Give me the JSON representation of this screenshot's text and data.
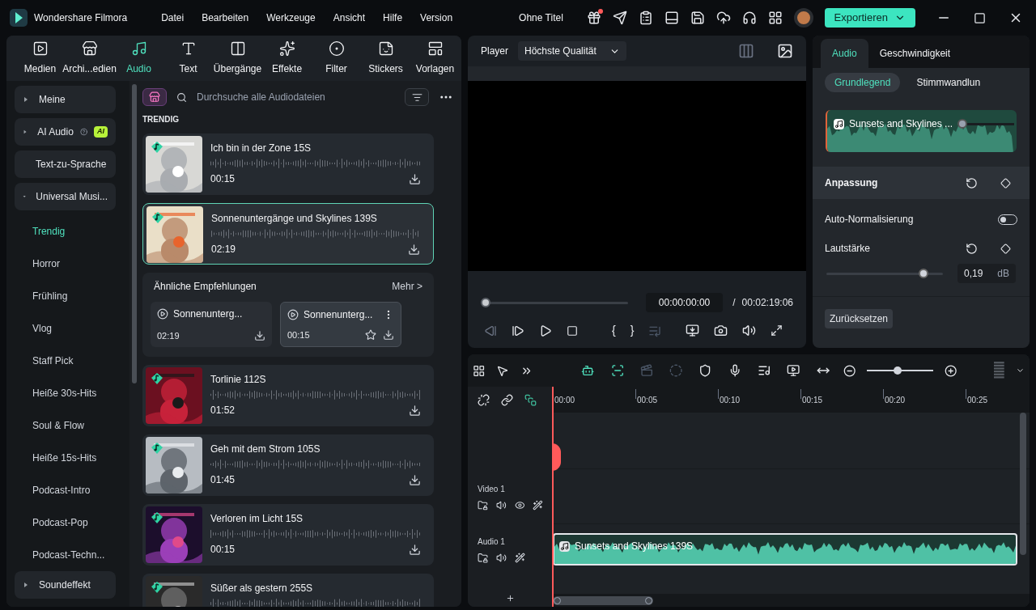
{
  "app": {
    "name": "Wondershare Filmora",
    "menus": [
      "Datei",
      "Bearbeiten",
      "Werkzeuge",
      "Ansicht",
      "Hilfe",
      "Version"
    ],
    "project_title": "Ohne Titel",
    "notification": true,
    "export_label": "Exportieren"
  },
  "media_tabs": [
    {
      "label": "Medien",
      "selected": false
    },
    {
      "label": "Archi...edien",
      "selected": false
    },
    {
      "label": "Audio",
      "selected": true
    },
    {
      "label": "Text",
      "selected": false
    },
    {
      "label": "Übergänge",
      "selected": false
    },
    {
      "label": "Effekte",
      "selected": false
    },
    {
      "label": "Filter",
      "selected": false
    },
    {
      "label": "Stickers",
      "selected": false
    },
    {
      "label": "Vorlagen",
      "selected": false
    }
  ],
  "sidebar": [
    {
      "kind": "group",
      "label": "Meine",
      "expanded": false
    },
    {
      "kind": "group",
      "label": "AI Audio",
      "expanded": false,
      "badge": "AI"
    },
    {
      "kind": "plain",
      "label": "Text-zu-Sprache"
    },
    {
      "kind": "group",
      "label": "Universal Musi...",
      "expanded": true,
      "children": [
        {
          "label": "Trendig",
          "selected": true
        },
        {
          "label": "Horror",
          "selected": false
        },
        {
          "label": "Frühling",
          "selected": false
        },
        {
          "label": "Vlog",
          "selected": false
        },
        {
          "label": "Staff Pick",
          "selected": false
        },
        {
          "label": "Heiße 30s-Hits",
          "selected": false
        },
        {
          "label": "Soul & Flow",
          "selected": false
        },
        {
          "label": "Heiße 15s-Hits",
          "selected": false
        },
        {
          "label": "Podcast-Intro",
          "selected": false
        },
        {
          "label": "Podcast-Pop",
          "selected": false
        },
        {
          "label": "Podcast-Techn...",
          "selected": false
        }
      ]
    },
    {
      "kind": "group",
      "label": "Soundeffekt",
      "expanded": false
    }
  ],
  "library": {
    "search_placeholder": "Durchsuche alle Audiodateien",
    "section": "TRENDIG",
    "items": [
      {
        "kind": "track",
        "title": "Ich bin in der Zone 15S",
        "duration": "00:15",
        "selected": false
      },
      {
        "kind": "track",
        "title": "Sonnenuntergänge und Skylines 139S",
        "duration": "02:19",
        "selected": true
      },
      {
        "kind": "recommendations",
        "title": "Ähnliche Empfehlungen",
        "more": "Mehr >",
        "items": [
          {
            "title": "Sonnenunterg...",
            "duration": "02:19",
            "highlighted": false
          },
          {
            "title": "Sonnenunterg...",
            "duration": "00:15",
            "highlighted": true
          }
        ]
      },
      {
        "kind": "track",
        "title": "Torlinie 112S",
        "duration": "01:52",
        "selected": false
      },
      {
        "kind": "track",
        "title": "Geh mit dem Strom 105S",
        "duration": "01:45",
        "selected": false
      },
      {
        "kind": "track",
        "title": "Verloren im Licht 15S",
        "duration": "00:15",
        "selected": false
      },
      {
        "kind": "track",
        "title": "Süßer als gestern 255S",
        "selected": false
      }
    ]
  },
  "player": {
    "label": "Player",
    "quality": "Höchste Qualität",
    "progress": {
      "level": 0
    },
    "current_time": "00:00:00:00",
    "separator": "/",
    "total_time": "00:02:19:06",
    "mark_in": "{",
    "mark_out": "}"
  },
  "inspector": {
    "tabs": [
      {
        "label": "Audio",
        "selected": true
      },
      {
        "label": "Geschwindigkeit",
        "selected": false
      }
    ],
    "subtabs": [
      {
        "label": "Grundlegend",
        "selected": true
      },
      {
        "label": "Stimmwandlun",
        "selected": false
      }
    ],
    "clip_title": "Sunsets and Skylines ...",
    "section": "Anpassung",
    "auto_normalization": {
      "label": "Auto-Normalisierung",
      "on": false
    },
    "volume": {
      "label": "Lautstärke",
      "level": 0.83,
      "value": "0,19",
      "unit": "dB"
    },
    "reset_label": "Zurücksetzen"
  },
  "timeline": {
    "zoom": {
      "level": 0.46
    },
    "ruler": [
      "00:00",
      "00:05",
      "00:10",
      "00:15",
      "00:20",
      "00:25"
    ],
    "tracks": [
      {
        "kind": "video",
        "label": "Video 1"
      },
      {
        "kind": "audio",
        "label": "Audio 1",
        "clip": "Sunsets and Skylines 139S"
      }
    ]
  }
}
